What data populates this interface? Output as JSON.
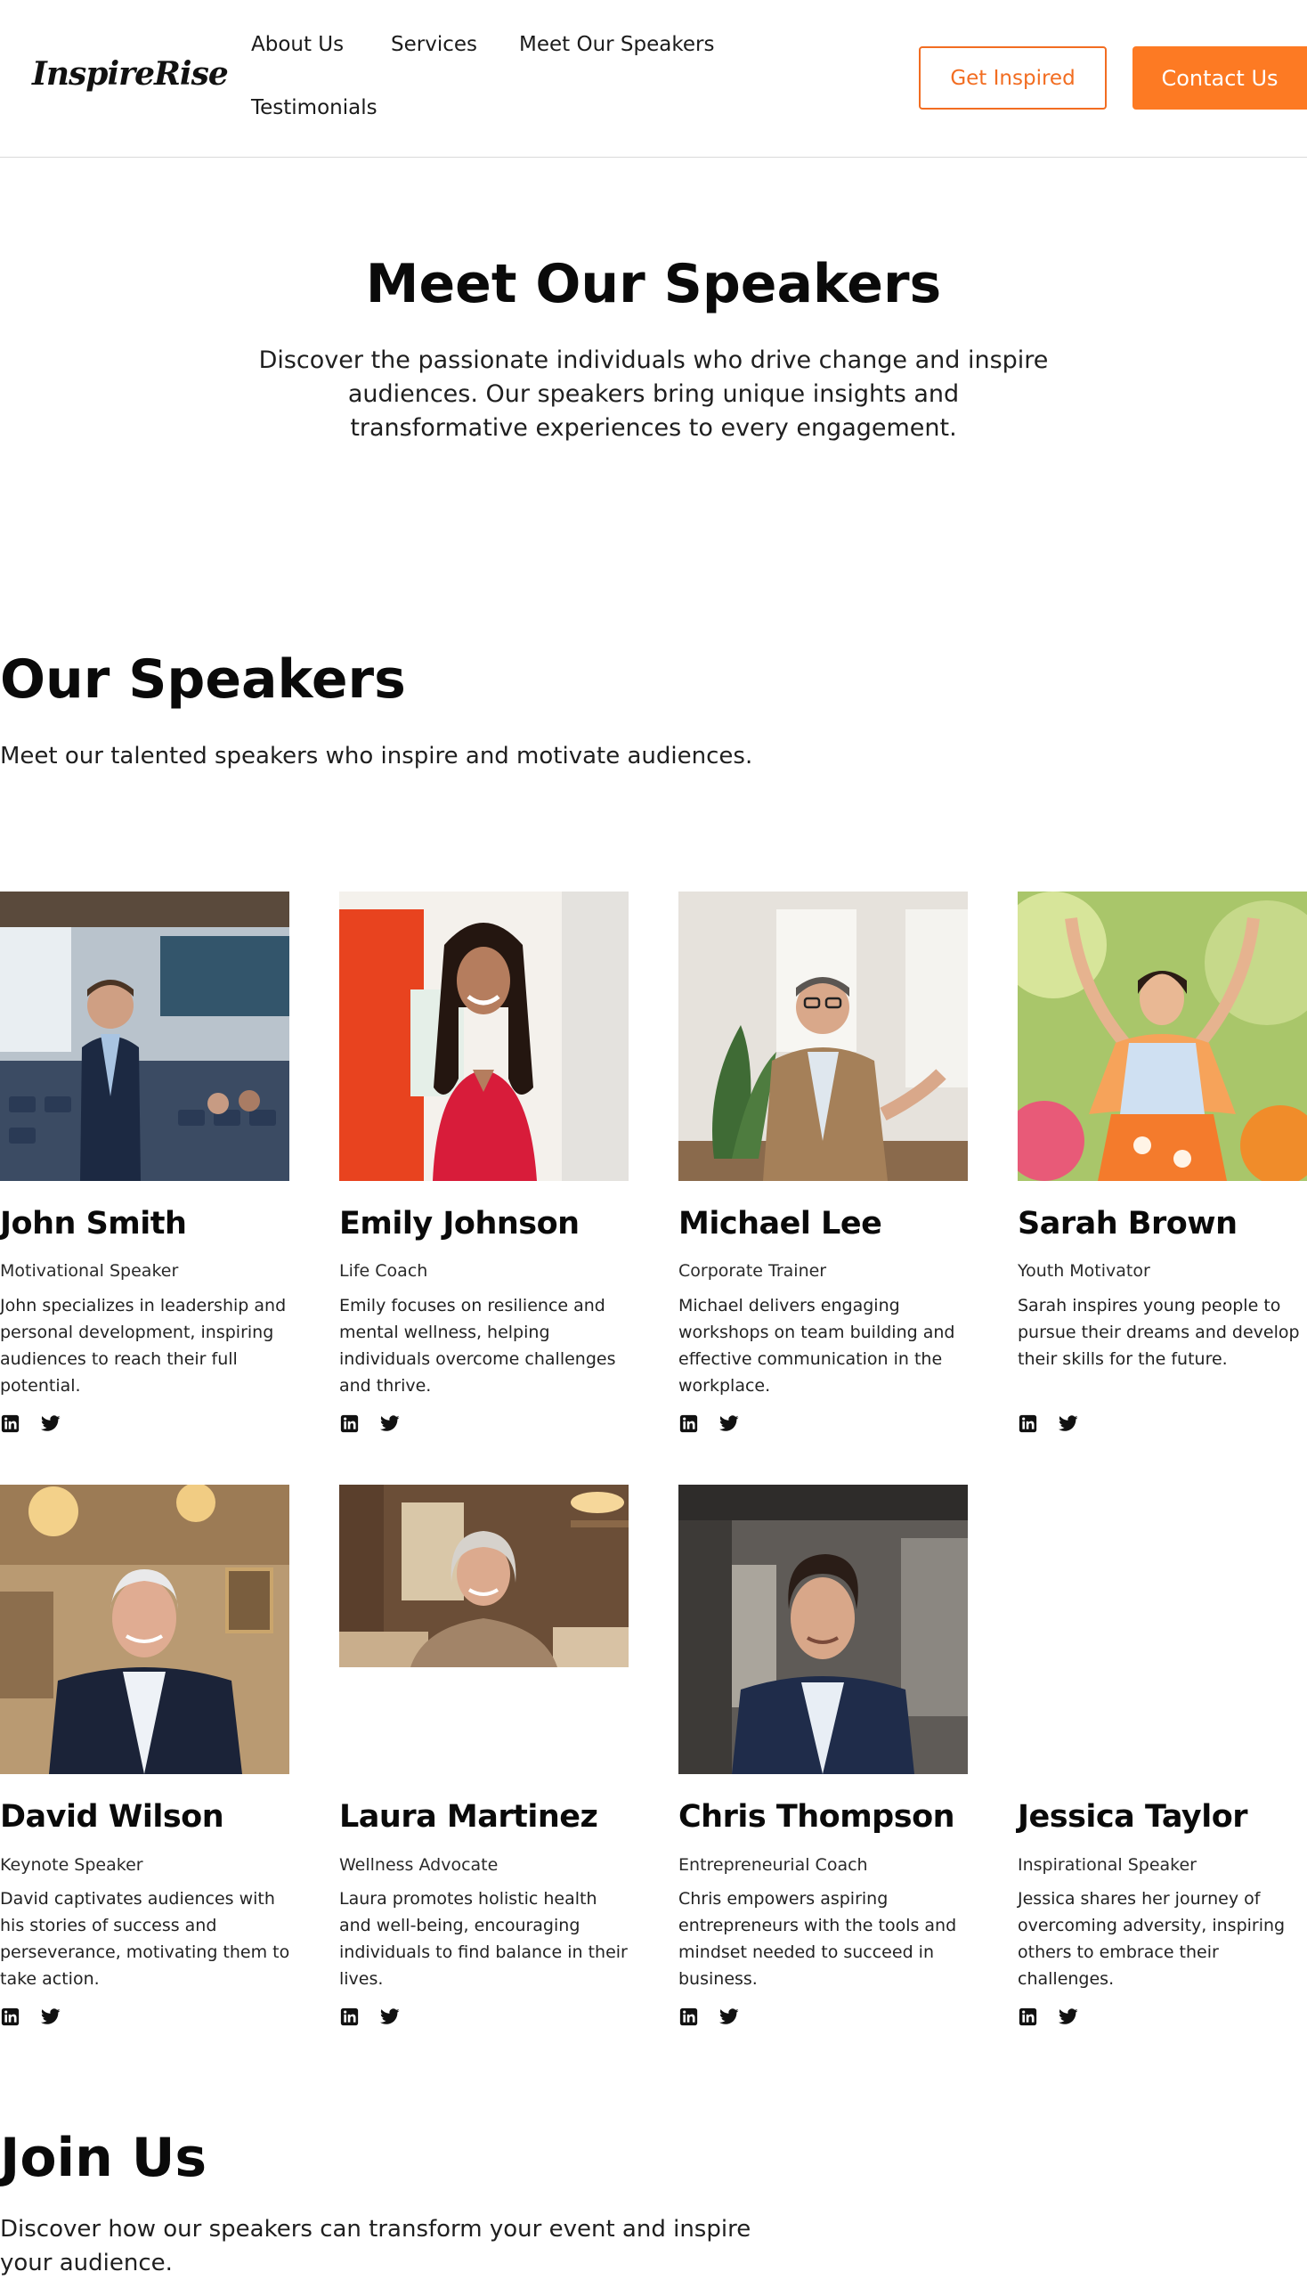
{
  "header": {
    "logo": "InspireRise",
    "nav": [
      "About Us",
      "Services",
      "Meet Our Speakers",
      "Testimonials"
    ],
    "cta_outline": "Get Inspired",
    "cta_solid": "Contact Us",
    "accent_color": "#fd7a23"
  },
  "hero": {
    "title": "Meet Our Speakers",
    "text": "Discover the passionate individuals who drive change and inspire audiences. Our speakers bring unique insights and transformative experiences to every engagement."
  },
  "speakers_section": {
    "title": "Our Speakers",
    "subtitle": "Meet our talented speakers who inspire and motivate audiences.",
    "speakers": [
      {
        "name": "John Smith",
        "role": "Motivational Speaker",
        "bio": "John specializes in leadership and personal development, inspiring audiences to reach their full potential.",
        "photo": "man in dark suit on stage"
      },
      {
        "name": "Emily Johnson",
        "role": "Life Coach",
        "bio": "Emily focuses on resilience and mental wellness, helping individuals overcome challenges and thrive.",
        "photo": "woman with curly hair in red top"
      },
      {
        "name": "Michael Lee",
        "role": "Corporate Trainer",
        "bio": "Michael delivers engaging workshops on team building and effective communication in the workplace.",
        "photo": "man in tan blazer gesturing"
      },
      {
        "name": "Sarah Brown",
        "role": "Youth Motivator",
        "bio": "Sarah inspires young people to pursue their dreams and develop their skills for the future.",
        "photo": "woman with raised arms outdoors"
      },
      {
        "name": "David Wilson",
        "role": "Keynote Speaker",
        "bio": "David captivates audiences with his stories of success and perseverance, motivating them to take action.",
        "photo": "gray-haired man in navy suit"
      },
      {
        "name": "Laura Martinez",
        "role": "Wellness Advocate",
        "bio": "Laura promotes holistic health and well-being, encouraging individuals to find balance in their lives.",
        "photo": "smiling older woman in cafe"
      },
      {
        "name": "Chris Thompson",
        "role": "Entrepreneurial Coach",
        "bio": "Chris empowers aspiring entrepreneurs with the tools and mindset needed to succeed in business.",
        "photo": "young man in blue blazer"
      },
      {
        "name": "Jessica Taylor",
        "role": "Inspirational Speaker",
        "bio": "Jessica shares her journey of overcoming adversity, inspiring others to embrace their challenges.",
        "photo": null
      }
    ],
    "social_icons": [
      "linkedin-icon",
      "twitter-icon"
    ]
  },
  "join": {
    "title": "Join Us",
    "text": "Discover how our speakers can transform your event and inspire your audience."
  }
}
